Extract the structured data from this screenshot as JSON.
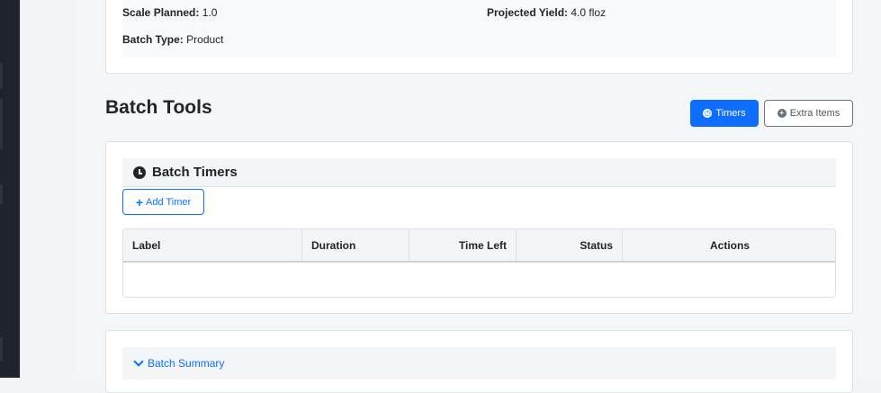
{
  "info": {
    "scale_label": "Scale Planned:",
    "scale_value": "1.0",
    "yield_label": "Projected Yield:",
    "yield_value": "4.0 floz",
    "batch_type_label": "Batch Type:",
    "batch_type_value": "Product"
  },
  "batch_tools": {
    "title": "Batch Tools",
    "timers_button": "Timers",
    "extra_items_button": "Extra Items"
  },
  "timers": {
    "title": "Batch Timers",
    "add_timer": "Add Timer",
    "columns": [
      "Label",
      "Duration",
      "Time Left",
      "Status",
      "Actions"
    ]
  },
  "summary": {
    "label": "Batch Summary"
  },
  "colors": {
    "primary": "#0d6efd",
    "sidebar": "#1f232b"
  }
}
